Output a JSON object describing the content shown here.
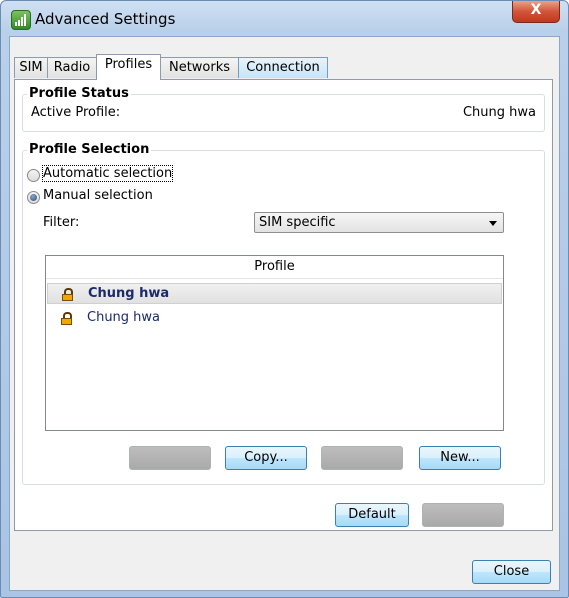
{
  "window": {
    "title": "Advanced Settings",
    "close_glyph": "X"
  },
  "tabs": [
    {
      "label": "SIM"
    },
    {
      "label": "Radio"
    },
    {
      "label": "Profiles"
    },
    {
      "label": "Networks"
    },
    {
      "label": "Connection"
    }
  ],
  "profile_status": {
    "legend": "Profile Status",
    "active_label": "Active Profile:",
    "active_value": "Chung hwa"
  },
  "profile_selection": {
    "legend": "Profile Selection",
    "automatic_label": "Automatic selection",
    "manual_label": "Manual selection",
    "selected_mode": "manual",
    "filter_label": "Filter:",
    "filter_value": "SIM specific"
  },
  "profile_list": {
    "header": "Profile",
    "rows": [
      {
        "name": "Chung hwa",
        "icon": "lock-icon",
        "selected": true
      },
      {
        "name": "Chung hwa",
        "icon": "lock-icon",
        "selected": false
      }
    ]
  },
  "list_buttons": {
    "copy": "Copy...",
    "new": "New..."
  },
  "panel_buttons": {
    "default": "Default"
  },
  "footer": {
    "close": "Close"
  },
  "colors": {
    "accent": "#3c7fb1",
    "selected_text": "#1b2a6b",
    "lock": "#f0a800"
  }
}
